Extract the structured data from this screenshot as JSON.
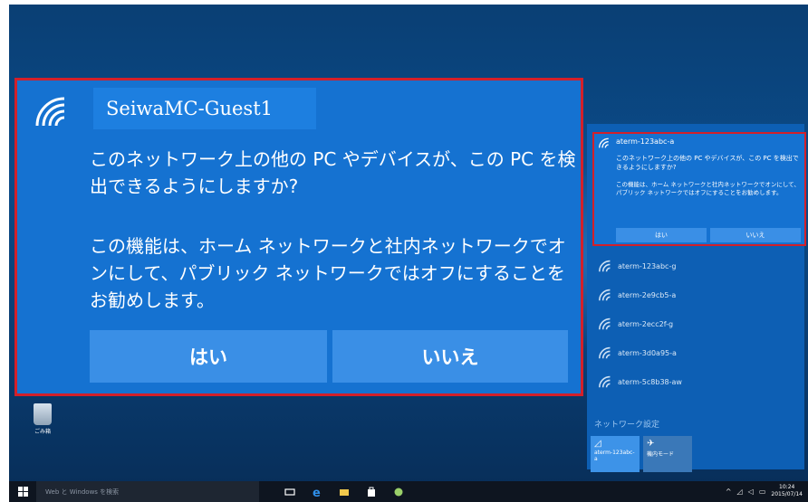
{
  "dialog": {
    "ssid": "SeiwaMC-Guest1",
    "question": "このネットワーク上の他の PC やデバイスが、この PC を検出できるようにしますか?",
    "info": "この機能は、ホーム ネットワークと社内ネットワークでオンにして、パブリック ネットワークではオフにすることをお勧めします。",
    "yes_label": "はい",
    "no_label": "いいえ"
  },
  "flyout": {
    "popup": {
      "ssid": "aterm-123abc-a",
      "question": "このネットワーク上の他の PC やデバイスが、この PC を検出できるようにしますか?",
      "info": "この機能は、ホーム ネットワークと社内ネットワークでオンにして、パブリック ネットワークではオフにすることをお勧めします。",
      "yes_label": "はい",
      "no_label": "いいえ"
    },
    "networks": [
      {
        "name": "aterm-123abc-g"
      },
      {
        "name": "aterm-2e9cb5-a"
      },
      {
        "name": "aterm-2ecc2f-g"
      },
      {
        "name": "aterm-3d0a95-a"
      },
      {
        "name": "aterm-5c8b38-aw"
      }
    ],
    "settings_label": "ネットワーク設定",
    "quick_actions": [
      {
        "icon": "wifi-icon",
        "label": "aterm-123abc-a"
      },
      {
        "icon": "airplane-icon",
        "label": "機内モード"
      }
    ]
  },
  "desktop": {
    "recycle_bin_label": "ごみ箱"
  },
  "taskbar": {
    "search_placeholder": "Web と Windows を検索",
    "clock_time": "10:24",
    "clock_date": "2015/07/14"
  },
  "colors": {
    "accent": "#1572d1",
    "highlight_border": "#d3202a",
    "taskbar": "#0e1520"
  }
}
